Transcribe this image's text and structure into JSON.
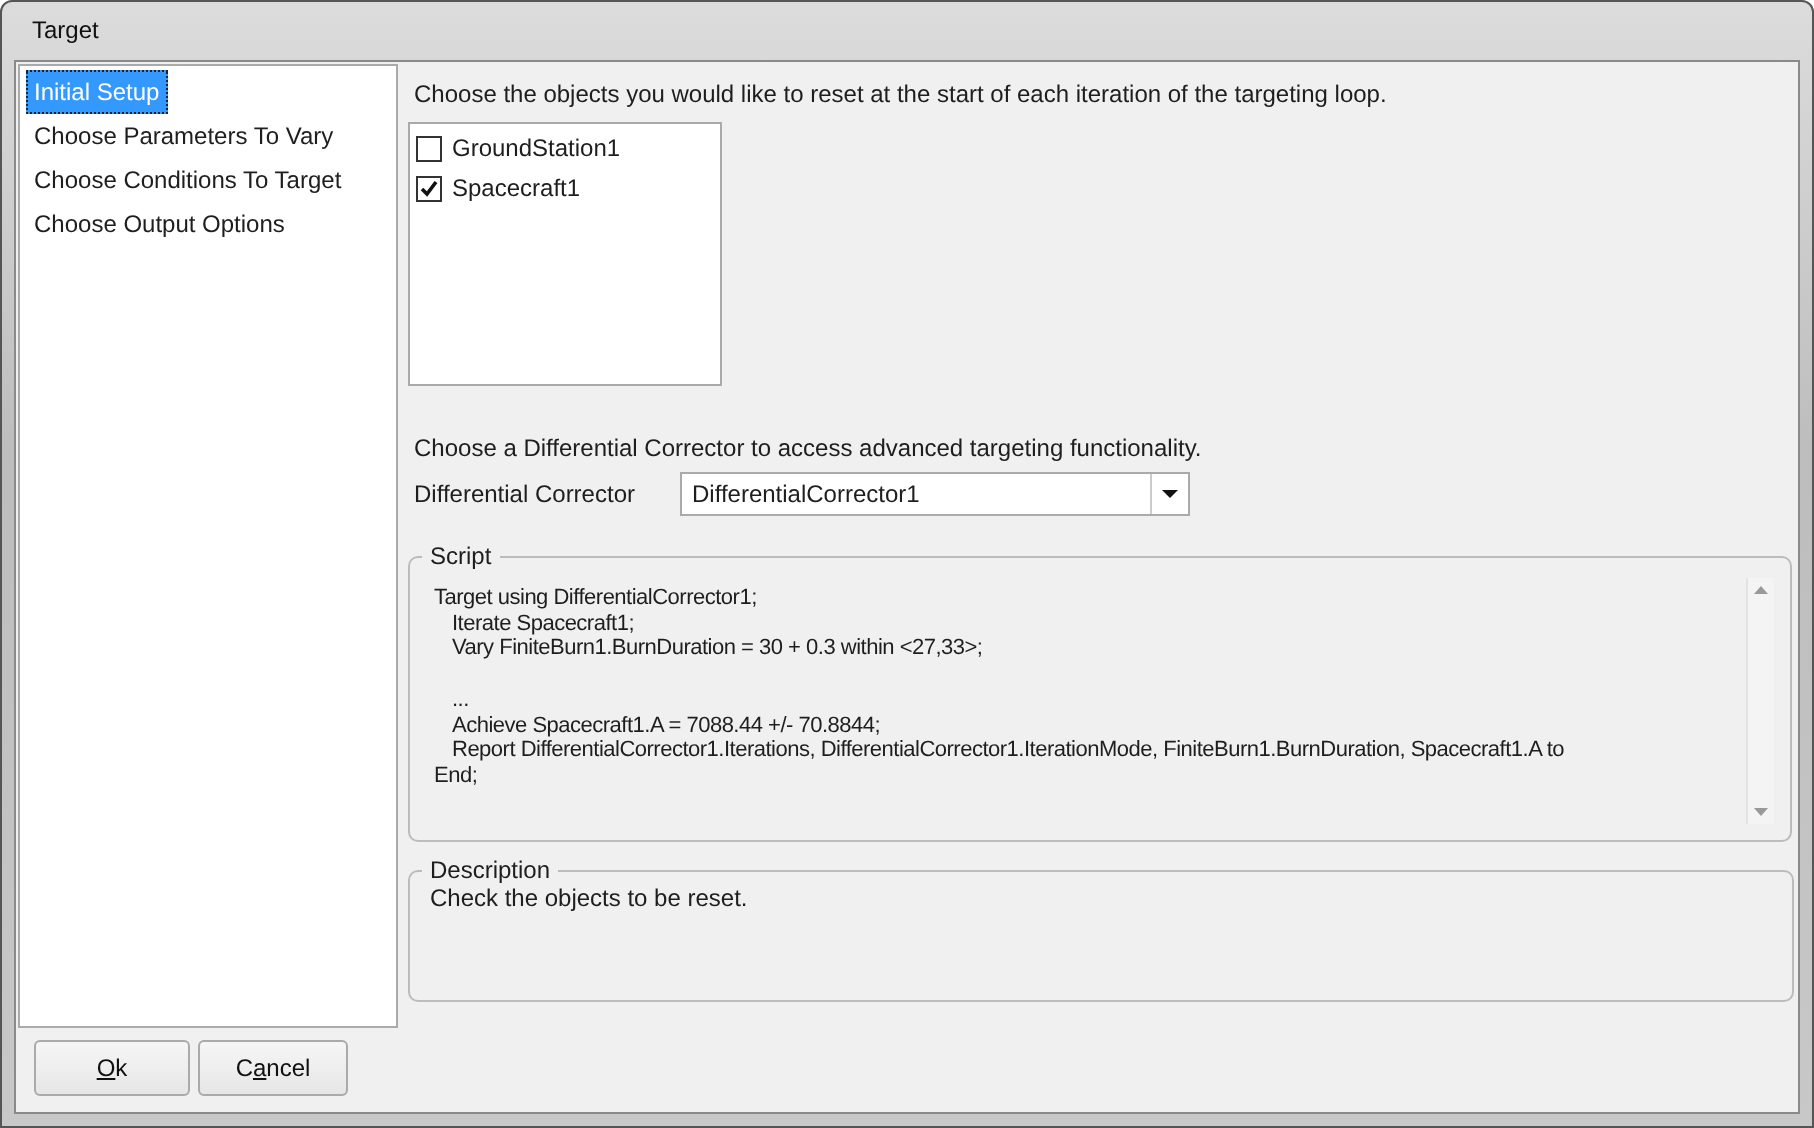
{
  "window": {
    "title": "Target"
  },
  "nav": {
    "items": [
      {
        "label": "Initial Setup",
        "selected": true
      },
      {
        "label": "Choose Parameters To Vary",
        "selected": false
      },
      {
        "label": "Choose Conditions To Target",
        "selected": false
      },
      {
        "label": "Choose Output Options",
        "selected": false
      }
    ]
  },
  "objects": {
    "prompt": "Choose the objects you would like to reset at the start of each iteration of the targeting loop.",
    "items": [
      {
        "label": "GroundStation1",
        "checked": false
      },
      {
        "label": "Spacecraft1",
        "checked": true
      }
    ]
  },
  "corrector": {
    "prompt": "Choose a Differential Corrector to access advanced targeting functionality.",
    "label": "Differential Corrector",
    "value": "DifferentialCorrector1"
  },
  "script": {
    "title": "Script",
    "lines": [
      {
        "text": "Target using DifferentialCorrector1;",
        "children": [
          {
            "text": "Iterate Spacecraft1;"
          },
          {
            "text": "Vary FiniteBurn1.BurnDuration = 30 + 0.3 within <27,33>;"
          },
          {
            "text": "...",
            "gap_before": true
          },
          {
            "text": "Achieve Spacecraft1.A = 7088.44 +/- 70.8844;"
          },
          {
            "text": "Report DifferentialCorrector1.Iterations, DifferentialCorrector1.IterationMode, FiniteBurn1.BurnDuration, Spacecraft1.A to"
          }
        ]
      },
      {
        "text": "End;"
      }
    ]
  },
  "description": {
    "title": "Description",
    "text": "Check the objects to be reset."
  },
  "buttons": [
    {
      "key": "O",
      "after": "k"
    },
    {
      "before": "C",
      "key": "a",
      "after": "ncel"
    }
  ]
}
